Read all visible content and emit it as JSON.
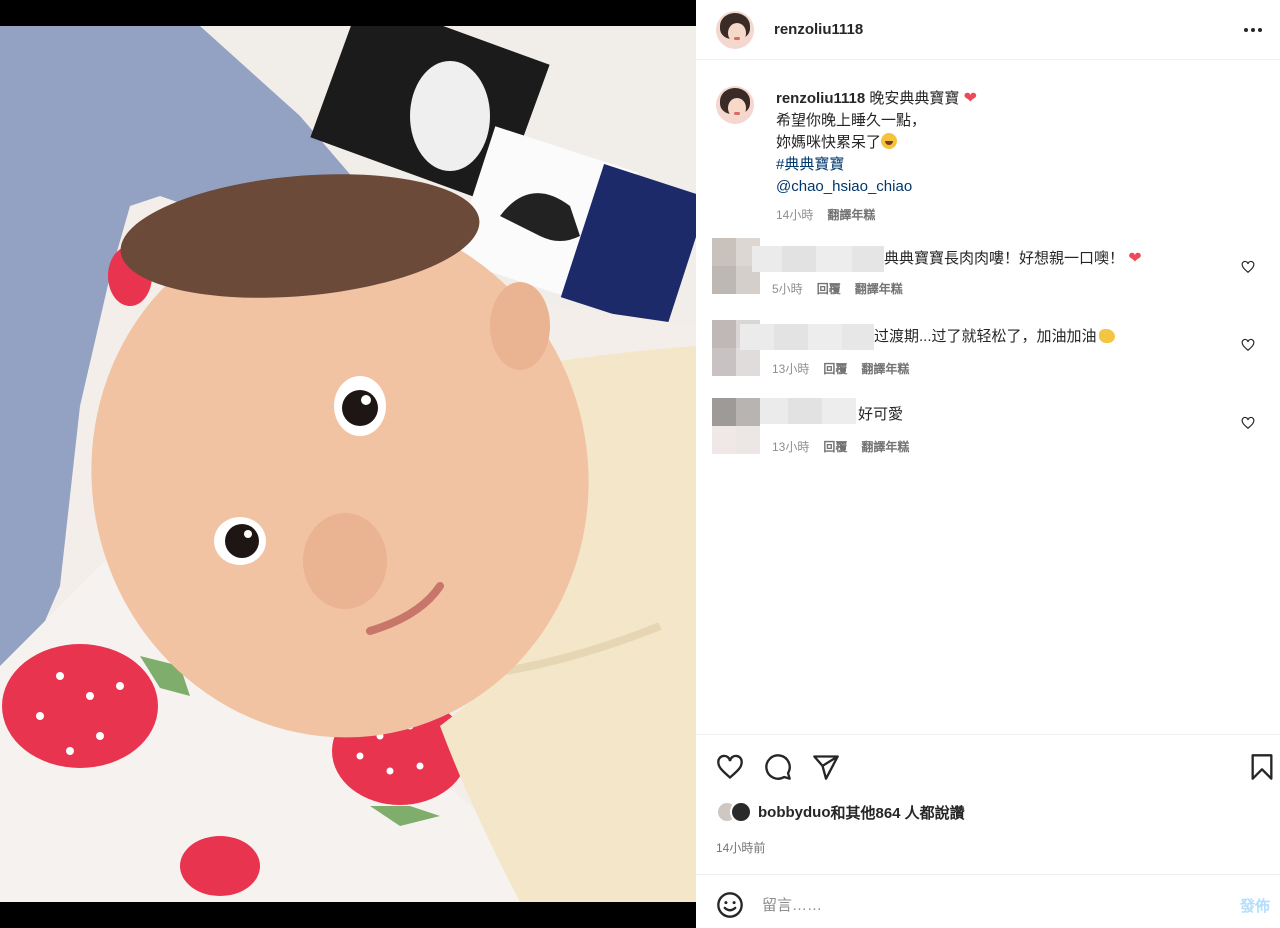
{
  "post": {
    "username": "renzoliu1118",
    "more_icon": "more-horizontal-icon"
  },
  "caption": {
    "username": "renzoliu1118",
    "line1": "晚安典典寶寶",
    "line2": "希望你晚上睡久一點，",
    "line3": "妳媽咪快累呆了",
    "hashtag": "#典典寶寶",
    "mention": "@chao_hsiao_chiao",
    "time": "14小時",
    "translate": "翻譯年糕"
  },
  "comments": [
    {
      "text": "典典寶寶長肉肉嘍！好想親一口噢！",
      "time": "5小時",
      "reply": "回覆",
      "translate": "翻譯年糕"
    },
    {
      "text": "过渡期...过了就轻松了，加油加油",
      "time": "13小時",
      "reply": "回覆",
      "translate": "翻譯年糕"
    },
    {
      "text": "好可愛",
      "time": "13小時",
      "reply": "回覆",
      "translate": "翻譯年糕"
    }
  ],
  "likes": {
    "user": "bobbyduo",
    "others": "和其他864 人都說讚"
  },
  "time_ago": "14小時前",
  "comment_box": {
    "placeholder": "留言……",
    "post_label": "發佈"
  },
  "colors": {
    "link": "#00376b",
    "like_red": "#ed4956",
    "post_disabled": "#b2dffc"
  }
}
